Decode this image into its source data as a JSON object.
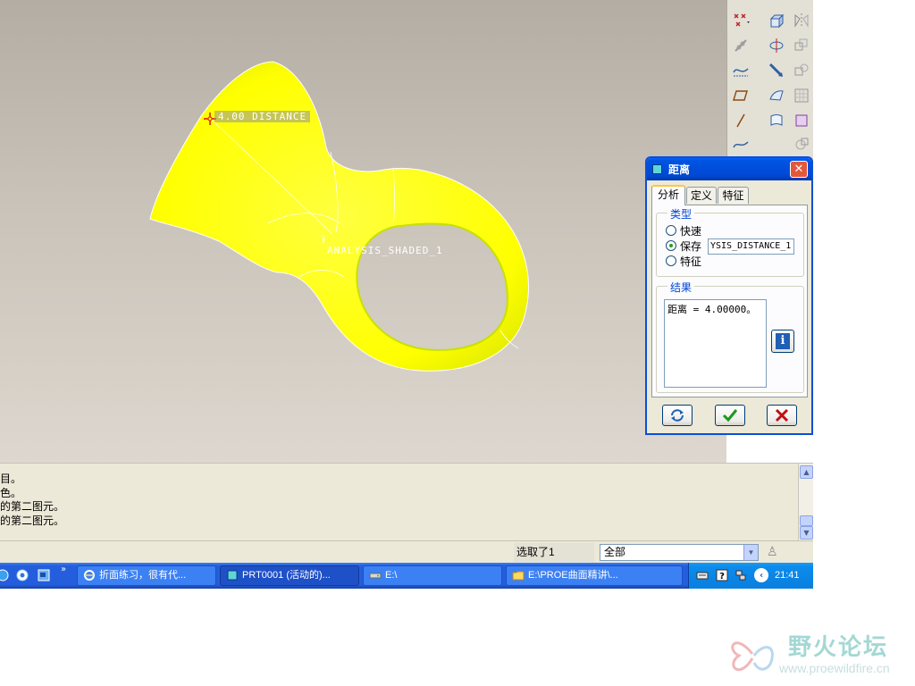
{
  "viewport": {
    "distance_label": "4.00  DISTANCE",
    "shaded_label": "ANALYSIS_SHADED_1"
  },
  "messages": [
    "目。",
    "色。",
    "的第二图元。",
    "的第二图元。"
  ],
  "status": {
    "selection_text": "选取了1",
    "filter_value": "全部"
  },
  "taskbar": {
    "quick_launch_more": "»",
    "tasks": [
      {
        "label": "折面练习，很有代..."
      },
      {
        "label": "PRT0001 (活动的)..."
      },
      {
        "label": "E:\\"
      },
      {
        "label": "E:\\PROE曲面精讲\\..."
      }
    ],
    "clock": "21:41"
  },
  "dialog": {
    "title": "距离",
    "tabs": [
      "分析",
      "定义",
      "特征"
    ],
    "type_group_label": "类型",
    "radio_options": [
      "快速",
      "保存",
      "特征"
    ],
    "selected_radio": "保存",
    "save_name_value": "YSIS_DISTANCE_1",
    "result_group_label": "结果",
    "result_text": "距离 = 4.00000。"
  },
  "watermark": {
    "name": "野火论坛",
    "url": "www.proewildfire.cn"
  },
  "colors": {
    "model_yellow": "#ffff00",
    "dialog_titlebar": "#0054e3",
    "taskbar": "#245edc"
  }
}
